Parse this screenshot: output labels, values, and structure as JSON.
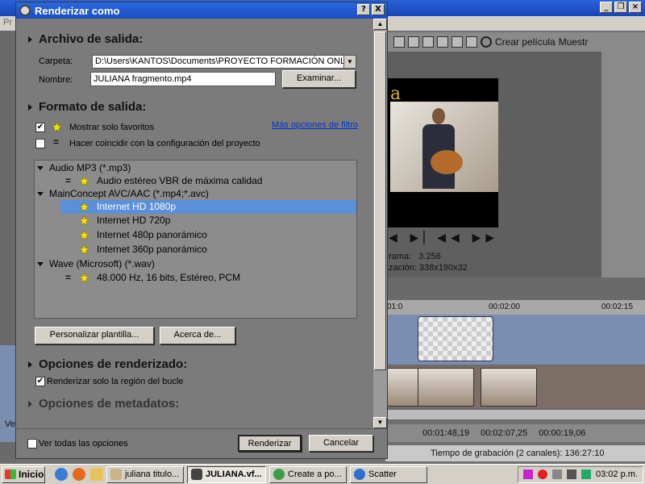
{
  "background": {
    "menu_partial": "Pr",
    "toolbar": {
      "create_movie_label": "Crear película",
      "show_label": "Muestr"
    },
    "preview": {
      "frame_label": "rama:",
      "frame_value": "3.256",
      "resolution_label": "zación:",
      "resolution_value": "338x190x32"
    },
    "ruler": {
      "t0": "01:0",
      "t1": "00:02:00",
      "t2": "00:02:15"
    },
    "times": {
      "cursor": "00:01:48,19",
      "end": "00:02:07,25",
      "length": "00:00:19,06"
    },
    "status": "Tiempo de grabación (2 canales): 136:27:10",
    "ve_label": "Ve"
  },
  "dialog": {
    "title": "Renderizar como",
    "help_btn": "?",
    "close_btn": "X",
    "output_file": {
      "heading": "Archivo de salida:",
      "folder_label": "Carpeta:",
      "folder_value": "D:\\Users\\KANTOS\\Documents\\PROYECTO FORMACIÓN ONLIN",
      "name_label": "Nombre:",
      "name_value": "JULIANA fragmento.mp4",
      "browse_button": "Examinar..."
    },
    "output_format": {
      "heading": "Formato de salida:",
      "show_favorites_label": "Mostrar solo favoritos",
      "show_favorites_checked": true,
      "match_project_label": "Hacer coincidir con la configuración del proyecto",
      "match_project_checked": false,
      "filter_link": "Más opciones de filtro",
      "tree": [
        {
          "label": "Audio MP3 (*.mp3)",
          "type": "group"
        },
        {
          "label": "Audio estéreo VBR de máxima calidad",
          "type": "item-eq"
        },
        {
          "label": "MainConcept AVC/AAC (*.mp4;*.avc)",
          "type": "group"
        },
        {
          "label": "Internet HD 1080p",
          "type": "item",
          "selected": true
        },
        {
          "label": "Internet HD 720p",
          "type": "item"
        },
        {
          "label": "Internet 480p panorámico",
          "type": "item"
        },
        {
          "label": "Internet 360p panorámico",
          "type": "item"
        },
        {
          "label": "Wave (Microsoft) (*.wav)",
          "type": "group"
        },
        {
          "label": "48.000 Hz, 16 bits, Estéreo, PCM",
          "type": "item-eq"
        }
      ],
      "customize_button": "Personalizar plantilla...",
      "about_button": "Acerca de..."
    },
    "render_options": {
      "heading": "Opciones de renderizado:",
      "loop_only_label": "Renderizar solo la región del bucle",
      "loop_only_checked": true
    },
    "metadata_options": {
      "heading": "Opciones de metadatos:"
    },
    "footer": {
      "all_options_label": "Ver todas las opciones",
      "render_button": "Renderizar",
      "cancel_button": "Cancelar"
    }
  },
  "taskbar": {
    "start_label": "Inicio",
    "tasks": [
      "juliana titulo...",
      "JULIANA.vf...",
      "Create a po...",
      "Scatter"
    ],
    "active_task_index": 1,
    "clock": "03:02 p.m."
  },
  "colors": {
    "titlebar": "#1a4dbf",
    "selection": "#5b8fd8",
    "link": "#0033cc",
    "star": "#f2e21a"
  }
}
